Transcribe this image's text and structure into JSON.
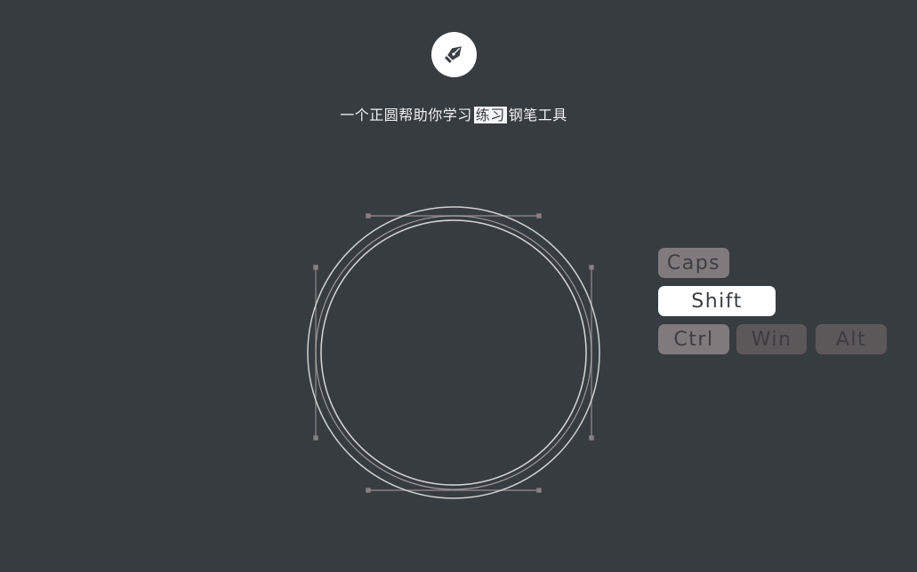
{
  "header": {
    "logo_icon": "pen-nib-icon",
    "title_before": "一个正圆帮助你学习",
    "title_highlight": "练习",
    "title_after": "钢笔工具"
  },
  "keyboard": {
    "caps": "Caps",
    "shift": "Shift",
    "ctrl": "Ctrl",
    "win": "Win",
    "alt": "Alt",
    "active_key": "Shift"
  },
  "colors": {
    "background": "#373c40",
    "key_active": "#ffffff",
    "key_normal": "#807a7c",
    "key_dim": "#5c5759",
    "circle_stroke": "#d8d8d8",
    "handle_color": "#8a7f82"
  }
}
